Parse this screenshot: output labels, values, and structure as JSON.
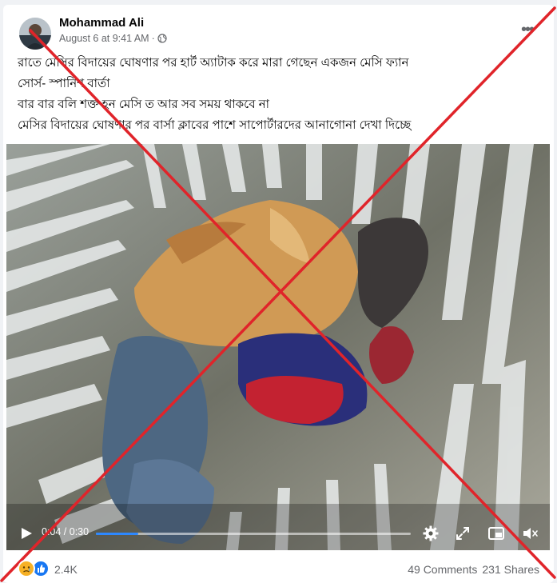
{
  "post": {
    "author": "Mohammad Ali",
    "timestamp": "August 6 at 9:41 AM",
    "separator": "·",
    "privacy_icon": "globe-icon",
    "more_icon": "more-options-icon",
    "text_lines": [
      "রাতে মেসির বিদায়ের ঘোষণার পর হার্ট অ্যাটাক করে মারা গেছেন একজন মেসি ফ্যান",
      "সোর্স- স্পানিশ বার্তা",
      "বার বার বলি শক্ত হন মেসি ত আর সব সময় থাকবে না",
      "মেসির বিদায়ের ঘোষণার পর বার্সা ক্লাবের পাশে সাপোর্টারদের আনাগোনা দেখা দিচ্ছে"
    ]
  },
  "video": {
    "time": "0:04 / 0:30",
    "progress_fraction": 0.1333,
    "play_icon": "play-icon",
    "settings_icon": "gear-icon",
    "fullscreen_icon": "fullscreen-icon",
    "pip_icon": "picture-in-picture-icon",
    "mute_icon": "volume-muted-icon"
  },
  "footer": {
    "reaction_icons": [
      "sad-reaction-icon",
      "like-reaction-icon"
    ],
    "reaction_count": "2.4K",
    "comments": "49 Comments",
    "shares": "231 Shares"
  },
  "colors": {
    "accent": "#2d88ff",
    "cross": "#e0242a",
    "text": "#050505",
    "muted": "#65676b"
  }
}
